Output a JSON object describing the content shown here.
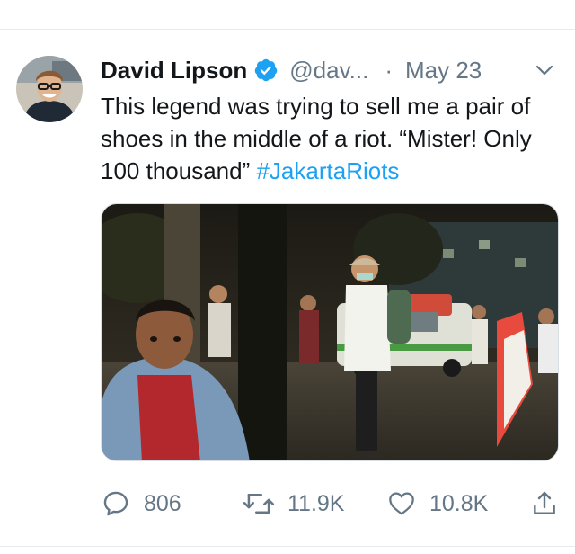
{
  "tweet": {
    "author": {
      "display_name": "David Lipson",
      "handle": "@dav...",
      "separator": "·",
      "date": "May 23",
      "verified_icon": "verified-badge-icon",
      "avatar": "author-avatar"
    },
    "text": {
      "body": "This legend was trying to sell me a pair of shoes in the middle of a riot. “Mister! Only 100 thousand” ",
      "hashtag": "#JakartaRiots"
    },
    "media": {
      "kind": "photo"
    },
    "actions": {
      "reply_count": "806",
      "retweet_count": "11.9K",
      "like_count": "10.8K",
      "reply_icon": "reply-icon",
      "retweet_icon": "retweet-icon",
      "like_icon": "heart-icon",
      "share_icon": "share-icon"
    },
    "colors": {
      "accent": "#1da1f2",
      "text": "#14171a",
      "muted": "#657786",
      "divider": "#e6ecf0"
    }
  }
}
